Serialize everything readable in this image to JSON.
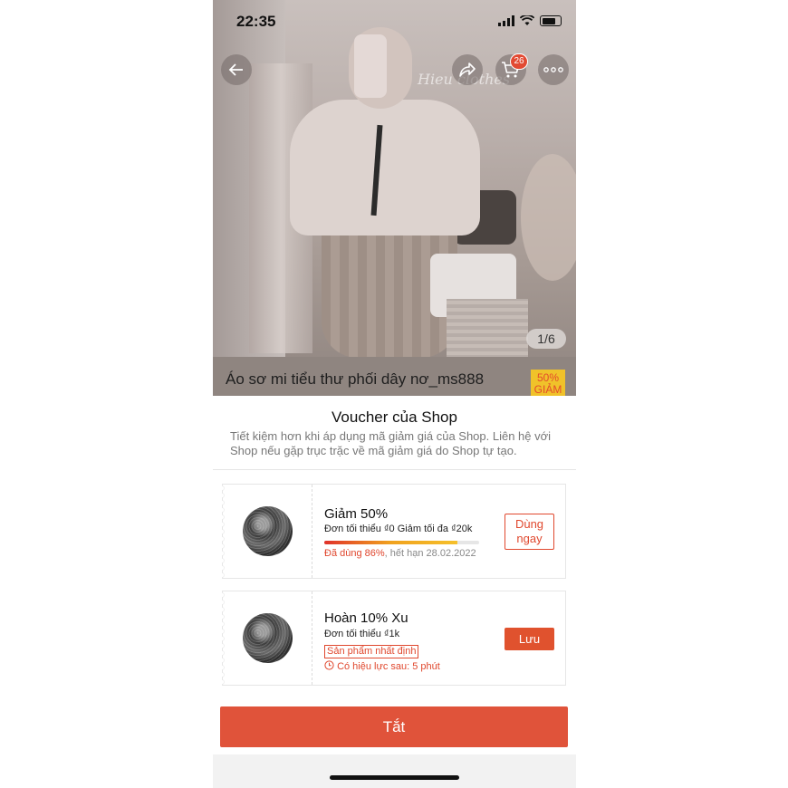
{
  "status_bar": {
    "time": "22:35"
  },
  "header": {
    "back_icon": "arrow-left-icon",
    "share_icon": "share-icon",
    "cart_icon": "cart-icon",
    "cart_count": "26",
    "more_icon": "more-horizontal-icon"
  },
  "product": {
    "watermark": "Hieu clothes",
    "image_index": "1/6",
    "title": "Áo sơ mi tiểu thư phối dây nơ_ms888",
    "discount_badge_line1": "50%",
    "discount_badge_line2": "GIẢM"
  },
  "sheet": {
    "title": "Voucher của Shop",
    "description": "Tiết kiệm hơn khi áp dụng mã giảm giá của Shop. Liên hệ với Shop nếu gặp trục trặc về mã giảm giá do Shop tự tạo.",
    "vouchers": [
      {
        "name": "Giảm 50%",
        "condition": "Đơn tối thiểu ₫0 Giảm tối đa ₫20k",
        "used_percent": 86,
        "used_text": "Đã dùng 86%",
        "expiry_text": ", hết hạn 28.02.2022",
        "button_label": "Dùng ngay"
      },
      {
        "name": "Hoàn 10% Xu",
        "condition": "Đơn tối thiểu ₫1k",
        "tag": "Sản phẩm nhất định",
        "valid_text": "Có hiệu lực sau: 5 phút",
        "button_label": "Lưu"
      }
    ],
    "close_label": "Tắt"
  },
  "colors": {
    "accent": "#e0533a",
    "badge_bg": "#f0c22a"
  }
}
